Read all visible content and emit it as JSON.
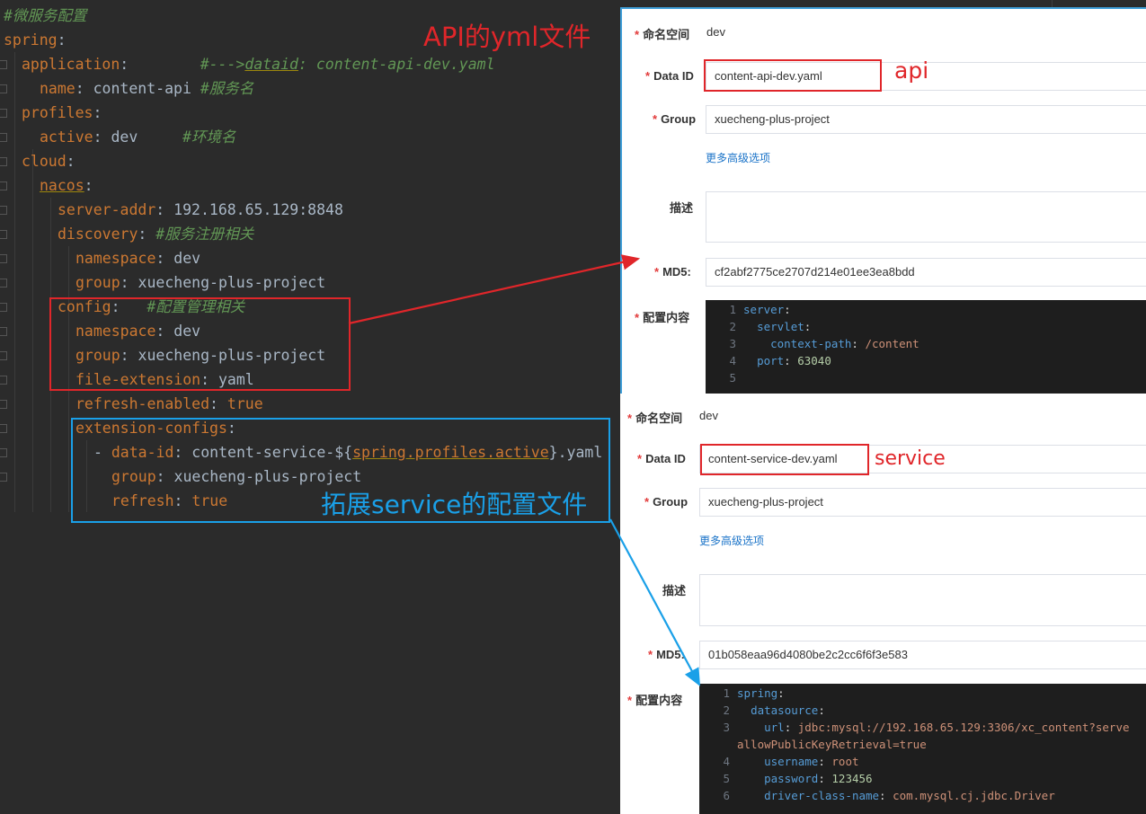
{
  "editor": {
    "lines": [
      {
        "indent": 0,
        "parts": [
          {
            "t": "#微服务配置",
            "c": "cmt"
          }
        ]
      },
      {
        "indent": 0,
        "parts": [
          {
            "t": "spring",
            "c": "k"
          },
          {
            "t": ":",
            "c": ""
          }
        ]
      },
      {
        "indent": 1,
        "parts": [
          {
            "t": "application",
            "c": "k"
          },
          {
            "t": ":        ",
            "c": ""
          },
          {
            "t": "#--->",
            "c": "cmt"
          },
          {
            "t": "dataid",
            "c": "cmt u"
          },
          {
            "t": ": content-api-dev.yaml",
            "c": "cmt"
          }
        ]
      },
      {
        "indent": 2,
        "parts": [
          {
            "t": "name",
            "c": "k"
          },
          {
            "t": ": content-api ",
            "c": ""
          },
          {
            "t": "#服务名",
            "c": "cmt"
          }
        ]
      },
      {
        "indent": 1,
        "parts": [
          {
            "t": "profiles",
            "c": "k"
          },
          {
            "t": ":",
            "c": ""
          }
        ]
      },
      {
        "indent": 2,
        "parts": [
          {
            "t": "active",
            "c": "k"
          },
          {
            "t": ": dev     ",
            "c": ""
          },
          {
            "t": "#环境名",
            "c": "cmt"
          }
        ]
      },
      {
        "indent": 1,
        "parts": [
          {
            "t": "cloud",
            "c": "k"
          },
          {
            "t": ":",
            "c": ""
          }
        ]
      },
      {
        "indent": 2,
        "parts": [
          {
            "t": "nacos",
            "c": "k u"
          },
          {
            "t": ":",
            "c": ""
          }
        ]
      },
      {
        "indent": 3,
        "parts": [
          {
            "t": "server-addr",
            "c": "k"
          },
          {
            "t": ": 192.168.65.129:8848",
            "c": ""
          }
        ]
      },
      {
        "indent": 3,
        "parts": [
          {
            "t": "discovery",
            "c": "k"
          },
          {
            "t": ": ",
            "c": ""
          },
          {
            "t": "#服务注册相关",
            "c": "cmt"
          }
        ]
      },
      {
        "indent": 4,
        "parts": [
          {
            "t": "namespace",
            "c": "k"
          },
          {
            "t": ": dev",
            "c": ""
          }
        ]
      },
      {
        "indent": 4,
        "parts": [
          {
            "t": "group",
            "c": "k"
          },
          {
            "t": ": xuecheng-plus-project",
            "c": ""
          }
        ]
      },
      {
        "indent": 3,
        "parts": [
          {
            "t": "config",
            "c": "k"
          },
          {
            "t": ":   ",
            "c": ""
          },
          {
            "t": "#配置管理相关",
            "c": "cmt"
          }
        ]
      },
      {
        "indent": 4,
        "parts": [
          {
            "t": "namespace",
            "c": "k"
          },
          {
            "t": ": dev",
            "c": ""
          }
        ]
      },
      {
        "indent": 4,
        "parts": [
          {
            "t": "group",
            "c": "k"
          },
          {
            "t": ": xuecheng-plus-project",
            "c": ""
          }
        ]
      },
      {
        "indent": 4,
        "parts": [
          {
            "t": "file-extension",
            "c": "k"
          },
          {
            "t": ": yaml",
            "c": ""
          }
        ]
      },
      {
        "indent": 4,
        "parts": [
          {
            "t": "refresh-enabled",
            "c": "k"
          },
          {
            "t": ": ",
            "c": ""
          },
          {
            "t": "true",
            "c": "k"
          }
        ]
      },
      {
        "indent": 4,
        "parts": [
          {
            "t": "extension-configs",
            "c": "k"
          },
          {
            "t": ":",
            "c": ""
          }
        ]
      },
      {
        "indent": 5,
        "parts": [
          {
            "t": "- ",
            "c": ""
          },
          {
            "t": "data-id",
            "c": "k"
          },
          {
            "t": ": content-service-${",
            "c": ""
          },
          {
            "t": "spring.profiles.active",
            "c": "k u"
          },
          {
            "t": "}.yaml",
            "c": ""
          }
        ]
      },
      {
        "indent": 6,
        "parts": [
          {
            "t": "group",
            "c": "k"
          },
          {
            "t": ": xuecheng-plus-project",
            "c": ""
          }
        ]
      },
      {
        "indent": 6,
        "parts": [
          {
            "t": "refresh",
            "c": "k"
          },
          {
            "t": ": ",
            "c": ""
          },
          {
            "t": "true",
            "c": "k"
          }
        ]
      }
    ]
  },
  "panel_api": {
    "namespace_label": "命名空间",
    "namespace_value": "dev",
    "dataid_label": "Data ID",
    "dataid_value": "content-api-dev.yaml",
    "group_label": "Group",
    "group_value": "xuecheng-plus-project",
    "advanced_link": "更多高级选项",
    "desc_label": "描述",
    "md5_label": "MD5:",
    "md5_value": "cf2abf2775ce2707d214e01ee3ea8bdd",
    "content_label": "配置内容",
    "code": [
      {
        "n": "1",
        "d": 0,
        "k": "server",
        "s": ":",
        "v": "",
        "vt": ""
      },
      {
        "n": "2",
        "d": 1,
        "k": "servlet",
        "s": ":",
        "v": "",
        "vt": ""
      },
      {
        "n": "3",
        "d": 2,
        "k": "context-path",
        "s": ": ",
        "v": "/content",
        "vt": "cv"
      },
      {
        "n": "4",
        "d": 1,
        "k": "port",
        "s": ": ",
        "v": "63040",
        "vt": "cn"
      },
      {
        "n": "5",
        "d": 0,
        "k": "",
        "s": "",
        "v": "",
        "vt": ""
      }
    ]
  },
  "panel_service": {
    "namespace_label": "命名空间",
    "namespace_value": "dev",
    "dataid_label": "Data ID",
    "dataid_value": "content-service-dev.yaml",
    "group_label": "Group",
    "group_value": "xuecheng-plus-project",
    "advanced_link": "更多高级选项",
    "desc_label": "描述",
    "md5_label": "MD5:",
    "md5_value": "01b058eaa96d4080be2c2cc6f6f3e583",
    "content_label": "配置内容",
    "code": [
      {
        "n": "1",
        "d": 0,
        "k": "spring",
        "s": ":",
        "v": "",
        "vt": ""
      },
      {
        "n": "2",
        "d": 1,
        "k": "datasource",
        "s": ":",
        "v": "",
        "vt": ""
      },
      {
        "n": "3",
        "d": 2,
        "k": "url",
        "s": ": ",
        "v": "jdbc:mysql://192.168.65.129:3306/xc_content?serve",
        "vt": "cv"
      },
      {
        "n": "",
        "d": 0,
        "k": "",
        "s": "",
        "v": "allowPublicKeyRetrieval=true",
        "vt": "cv"
      },
      {
        "n": "4",
        "d": 2,
        "k": "username",
        "s": ": ",
        "v": "root",
        "vt": "cv"
      },
      {
        "n": "5",
        "d": 2,
        "k": "password",
        "s": ": ",
        "v": "123456",
        "vt": "cn"
      },
      {
        "n": "6",
        "d": 2,
        "k": "driver-class-name",
        "s": ": ",
        "v": "com.mysql.cj.jdbc.Driver",
        "vt": "cv"
      }
    ]
  },
  "annotations": {
    "api_yml_title": "API的yml文件",
    "api_tag": "api",
    "service_tag": "service",
    "ext_service_title": "拓展service的配置文件",
    "red_color": "#e0262a",
    "blue_color": "#1aa0e8"
  }
}
